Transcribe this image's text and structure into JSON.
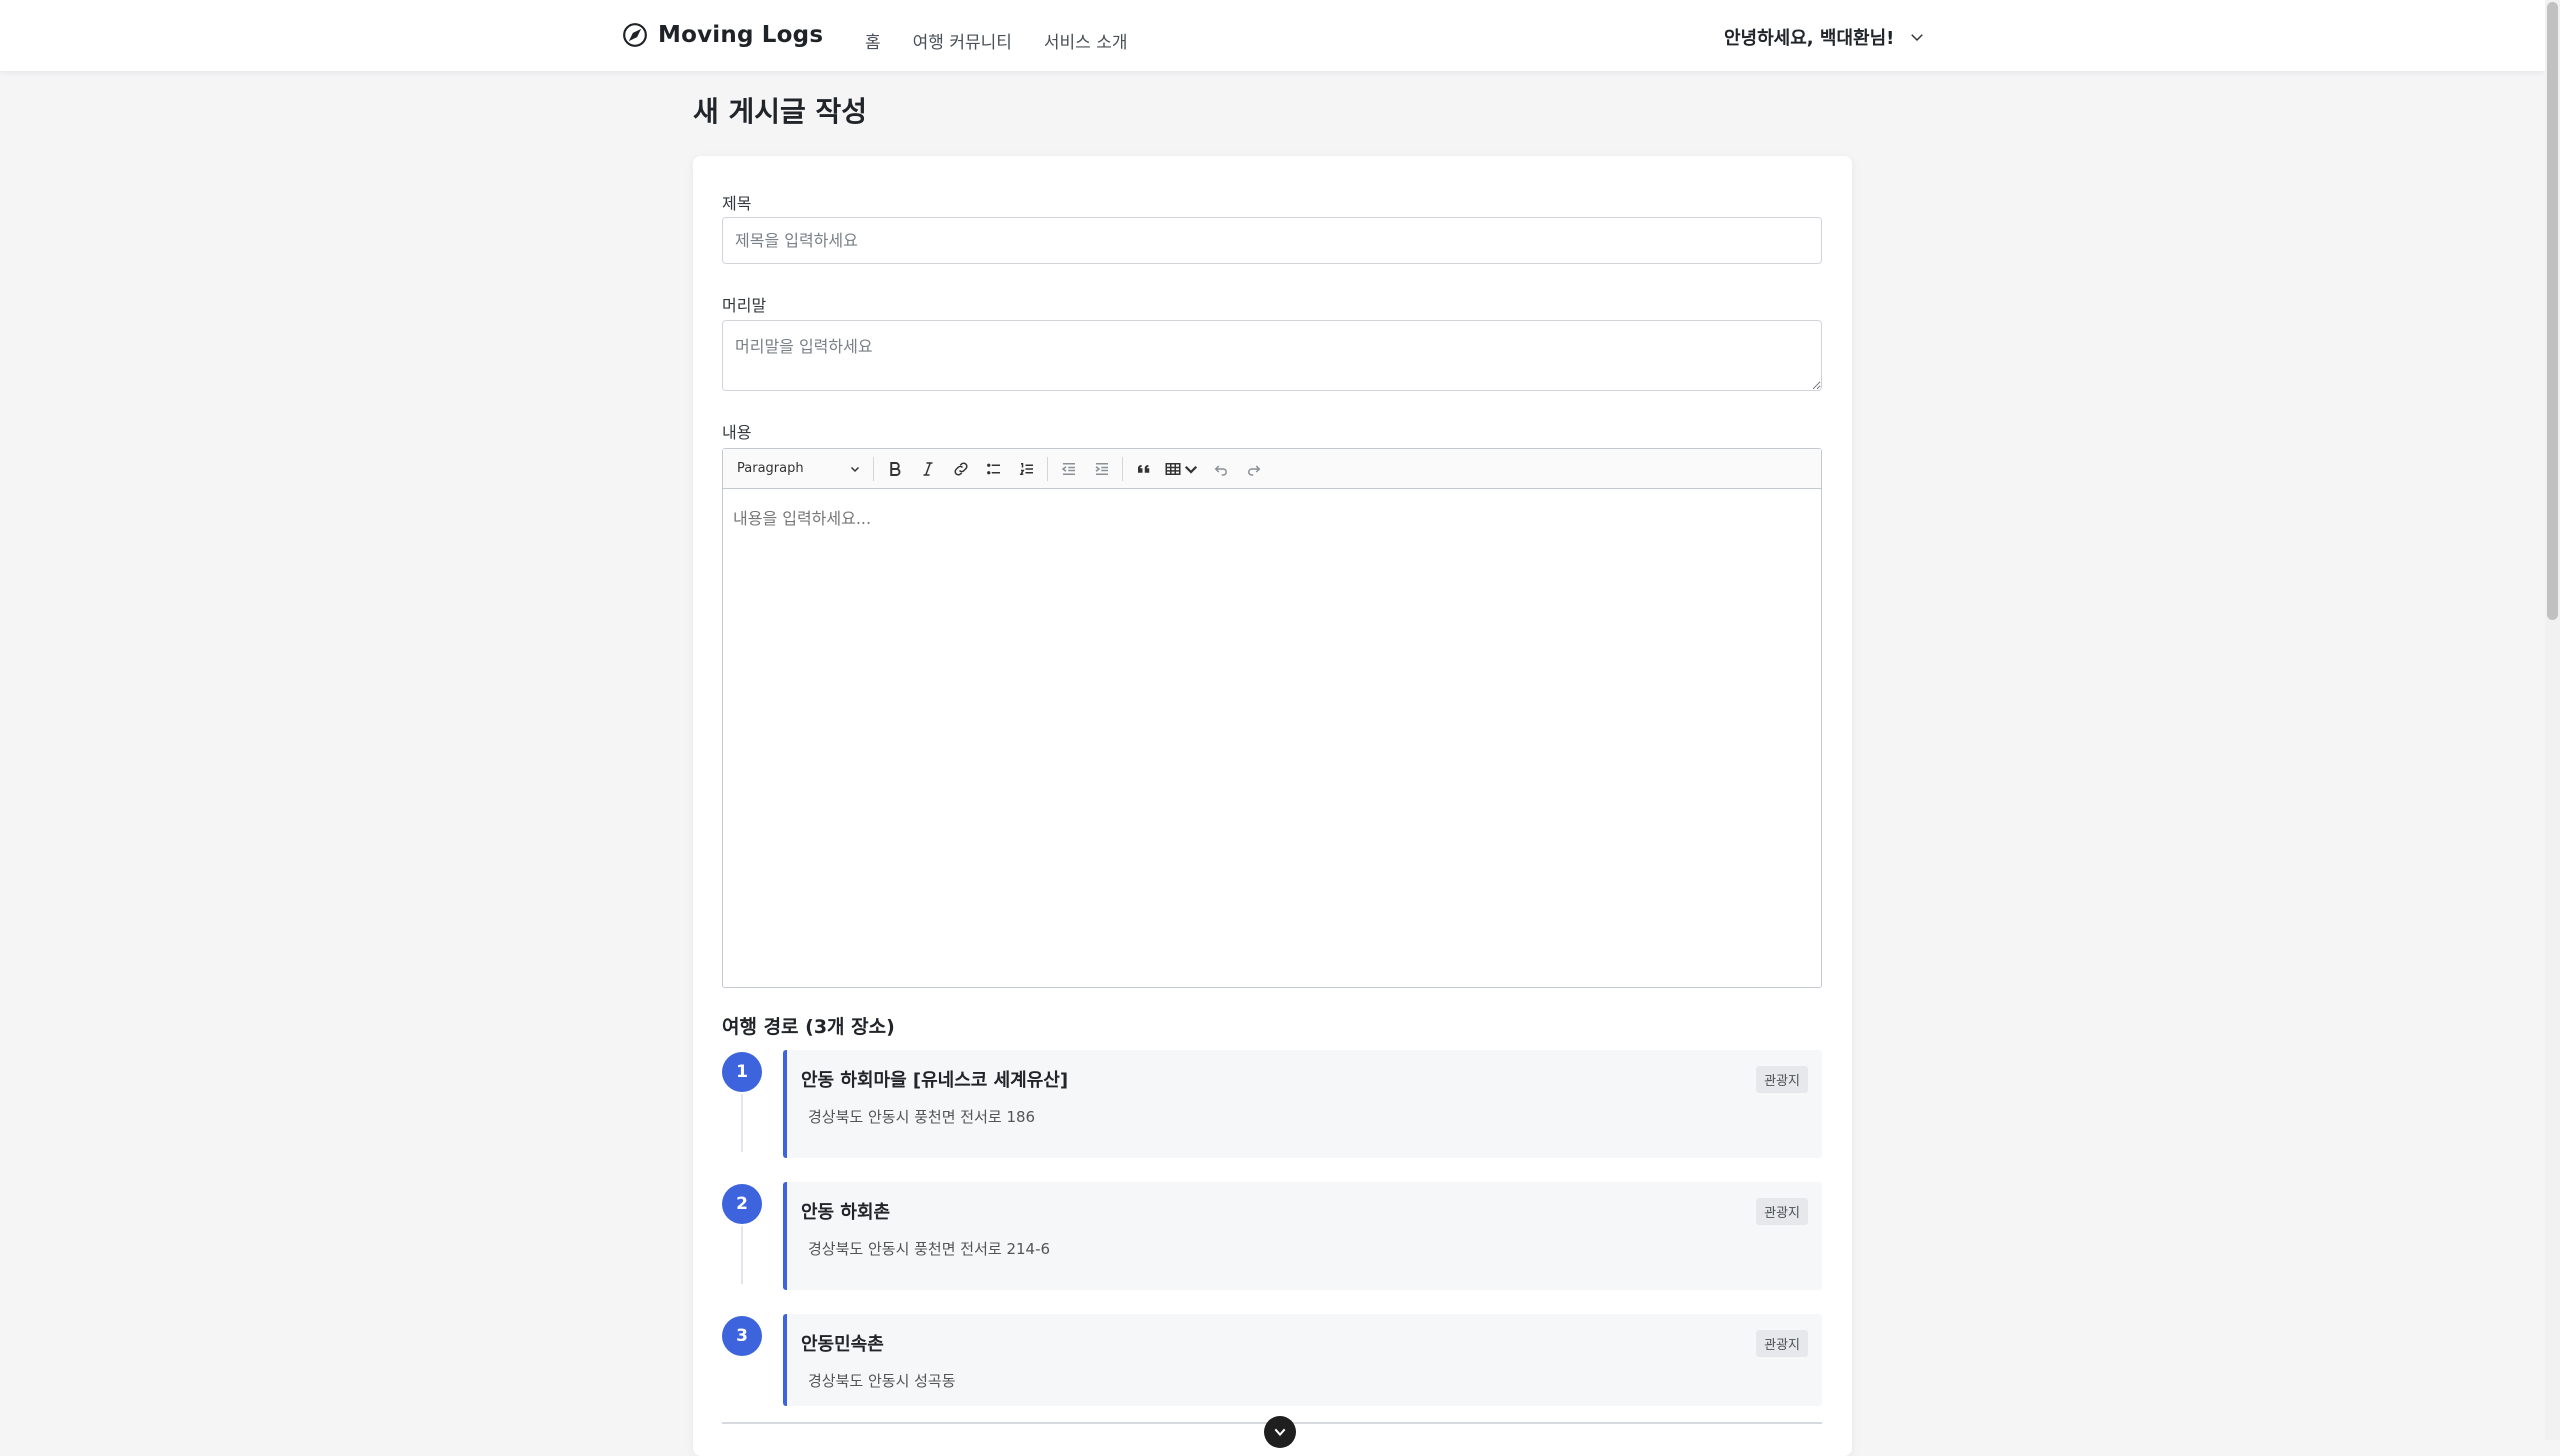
{
  "nav": {
    "brand": "Moving Logs",
    "links": [
      "홈",
      "여행 커뮤니티",
      "서비스 소개"
    ],
    "user_greeting": "안녕하세요, 백대환님!"
  },
  "page": {
    "title": "새 게시글 작성"
  },
  "form": {
    "title_label": "제목",
    "title_placeholder": "제목을 입력하세요",
    "intro_label": "머리말",
    "intro_placeholder": "머리말을 입력하세요",
    "content_label": "내용",
    "content_placeholder": "내용을 입력하세요..."
  },
  "editor": {
    "paragraph_select": "Paragraph",
    "toolbar_icons": [
      "bold-icon",
      "italic-icon",
      "link-icon",
      "bulleted-list-icon",
      "numbered-list-icon",
      "outdent-icon",
      "indent-icon",
      "blockquote-icon",
      "table-icon",
      "undo-icon",
      "redo-icon"
    ]
  },
  "route": {
    "title": "여행 경로 (3개 장소)",
    "items": [
      {
        "num": "1",
        "name": "안동 하회마을 [유네스코 세계유산]",
        "address": "경상북도 안동시 풍천면 전서로 186",
        "badge": "관광지"
      },
      {
        "num": "2",
        "name": "안동 하회촌",
        "address": "경상북도 안동시 풍천면 전서로 214-6",
        "badge": "관광지"
      },
      {
        "num": "3",
        "name": "안동민속촌",
        "address": "경상북도 안동시 성곡동",
        "badge": "관광지"
      }
    ]
  },
  "colors": {
    "accent": "#3d63dd",
    "page_bg": "#f5f5f6"
  }
}
